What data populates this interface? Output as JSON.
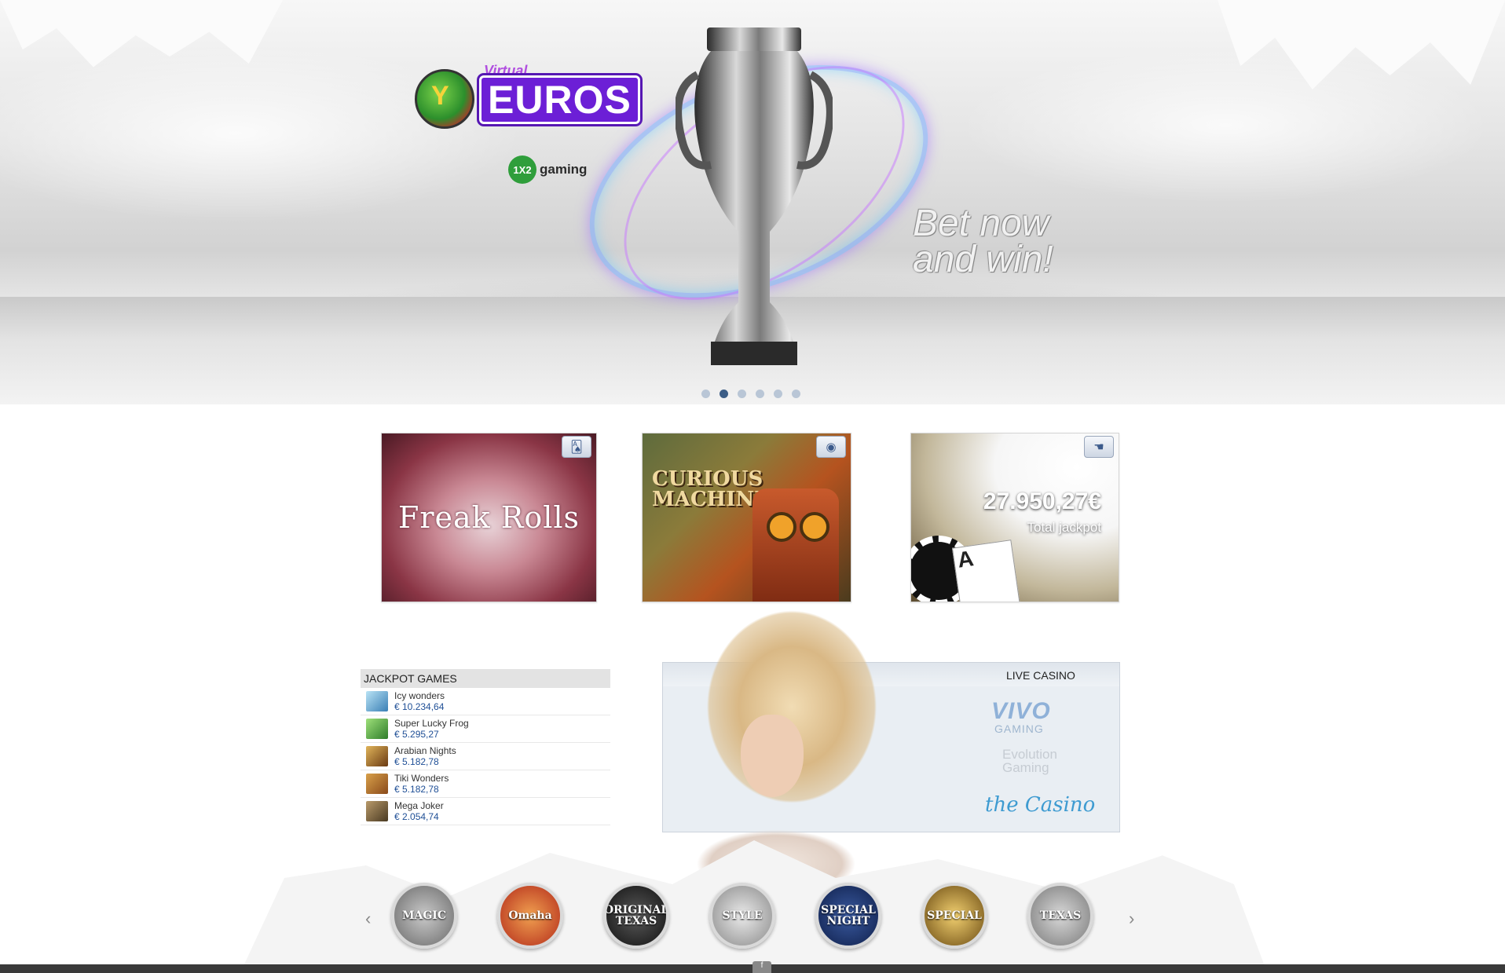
{
  "hero": {
    "logo_virtual": "Virtual",
    "logo_title": "EUROS",
    "provider_badge": "1X2",
    "provider_name": "gaming",
    "tagline_line1": "Bet now",
    "tagline_line2": "and win!",
    "slide_count": 6,
    "active_slide": 2
  },
  "promos": [
    {
      "title": "Freak Rolls",
      "icon": "cards-icon"
    },
    {
      "title": "CURIOUS MACHINE",
      "icon": "chip-icon"
    },
    {
      "amount": "27.950,27€",
      "label": "Total jackpot",
      "icon": "hand-icon"
    }
  ],
  "jackpot_games": {
    "title": "JACKPOT GAMES",
    "items": [
      {
        "name": "Icy wonders",
        "value": "€ 10.234,64"
      },
      {
        "name": "Super Lucky Frog",
        "value": "€ 5.295,27"
      },
      {
        "name": "Arabian Nights",
        "value": "€ 5.182,78"
      },
      {
        "name": "Tiki Wonders",
        "value": "€ 5.182,78"
      },
      {
        "name": "Mega Joker",
        "value": "€ 2.054,74"
      }
    ]
  },
  "live_casino": {
    "title": "LIVE CASINO",
    "providers": [
      {
        "name": "VIVO",
        "sub": "GAMING"
      },
      {
        "name": "Evolution",
        "sub": "Gaming"
      },
      {
        "name": "the Casino"
      }
    ]
  },
  "carousel": {
    "prev": "‹",
    "next": "›",
    "games": [
      "MAGIC",
      "Omaha",
      "ORIGINAL TEXAS",
      "STYLE",
      "SPECIAL NIGHT",
      "SPECIAL",
      "TEXAS"
    ]
  },
  "colors": {
    "accent": "#6c1fd6",
    "link_value": "#1f4f96",
    "dot_active": "#3c5d86"
  }
}
